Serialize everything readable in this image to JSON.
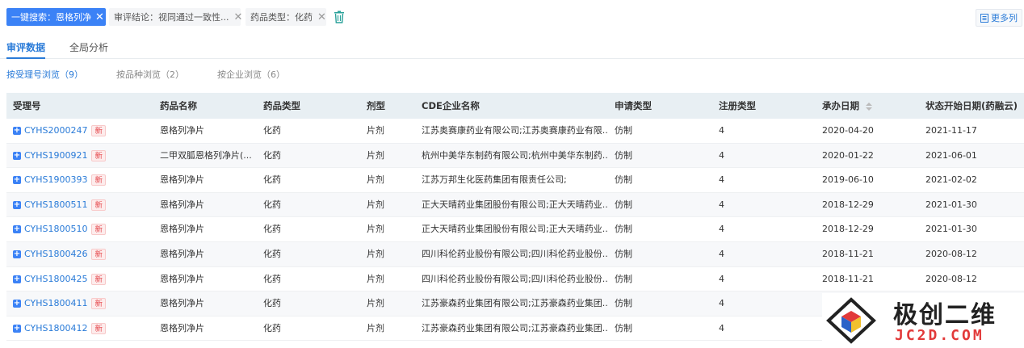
{
  "filters": {
    "chip1_label": "一键搜索：恩格列净",
    "chip2_label": "审评结论：视同通过一致性...",
    "chip3_label": "药品类型：化药",
    "more_columns_label": "更多列"
  },
  "tabs": [
    {
      "label": "审评数据"
    },
    {
      "label": "全局分析"
    }
  ],
  "subtabs": [
    {
      "label": "按受理号浏览（9）"
    },
    {
      "label": "按品种浏览（2）"
    },
    {
      "label": "按企业浏览（6）"
    }
  ],
  "table": {
    "headers": [
      "受理号",
      "药品名称",
      "药品类型",
      "剂型",
      "CDE企业名称",
      "申请类型",
      "注册类型",
      "承办日期",
      "状态开始日期(药融云)"
    ],
    "new_badge": "新",
    "rows": [
      {
        "code": "CYHS2000247",
        "name": "恩格列净片",
        "type": "化药",
        "form": "片剂",
        "company": "江苏奥赛康药业有限公司;江苏奥赛康药业有限...",
        "apply": "仿制",
        "reg": "4",
        "date": "2020-04-20",
        "status_date": "2021-11-17"
      },
      {
        "code": "CYHS1900921",
        "name": "二甲双胍恩格列净片(...",
        "type": "化药",
        "form": "片剂",
        "company": "杭州中美华东制药有限公司;杭州中美华东制药...",
        "apply": "仿制",
        "reg": "4",
        "date": "2020-01-22",
        "status_date": "2021-06-01"
      },
      {
        "code": "CYHS1900393",
        "name": "恩格列净片",
        "type": "化药",
        "form": "片剂",
        "company": "江苏万邦生化医药集团有限责任公司;",
        "apply": "仿制",
        "reg": "4",
        "date": "2019-06-10",
        "status_date": "2021-02-02"
      },
      {
        "code": "CYHS1800511",
        "name": "恩格列净片",
        "type": "化药",
        "form": "片剂",
        "company": "正大天晴药业集团股份有限公司;正大天晴药业...",
        "apply": "仿制",
        "reg": "4",
        "date": "2018-12-29",
        "status_date": "2021-01-30"
      },
      {
        "code": "CYHS1800510",
        "name": "恩格列净片",
        "type": "化药",
        "form": "片剂",
        "company": "正大天晴药业集团股份有限公司;正大天晴药业...",
        "apply": "仿制",
        "reg": "4",
        "date": "2018-12-29",
        "status_date": "2021-01-30"
      },
      {
        "code": "CYHS1800426",
        "name": "恩格列净片",
        "type": "化药",
        "form": "片剂",
        "company": "四川科伦药业股份有限公司;四川科伦药业股份...",
        "apply": "仿制",
        "reg": "4",
        "date": "2018-11-21",
        "status_date": "2020-08-12"
      },
      {
        "code": "CYHS1800425",
        "name": "恩格列净片",
        "type": "化药",
        "form": "片剂",
        "company": "四川科伦药业股份有限公司;四川科伦药业股份...",
        "apply": "仿制",
        "reg": "4",
        "date": "2018-11-21",
        "status_date": "2020-08-12"
      },
      {
        "code": "CYHS1800411",
        "name": "恩格列净片",
        "type": "化药",
        "form": "片剂",
        "company": "江苏豪森药业集团有限公司;江苏豪森药业集团...",
        "apply": "仿制",
        "reg": "4",
        "date": "",
        "status_date": ""
      },
      {
        "code": "CYHS1800412",
        "name": "恩格列净片",
        "type": "化药",
        "form": "片剂",
        "company": "江苏豪森药业集团有限公司;江苏豪森药业集团...",
        "apply": "仿制",
        "reg": "4",
        "date": "",
        "status_date": ""
      }
    ]
  },
  "watermark": {
    "title": "极创二维",
    "subtitle": "JC2D.COM"
  },
  "colors": {
    "accent": "#2a7bd8",
    "chip_primary": "#3b82f6",
    "header_bg": "#e8eff3",
    "badge_red": "#e5484d"
  }
}
